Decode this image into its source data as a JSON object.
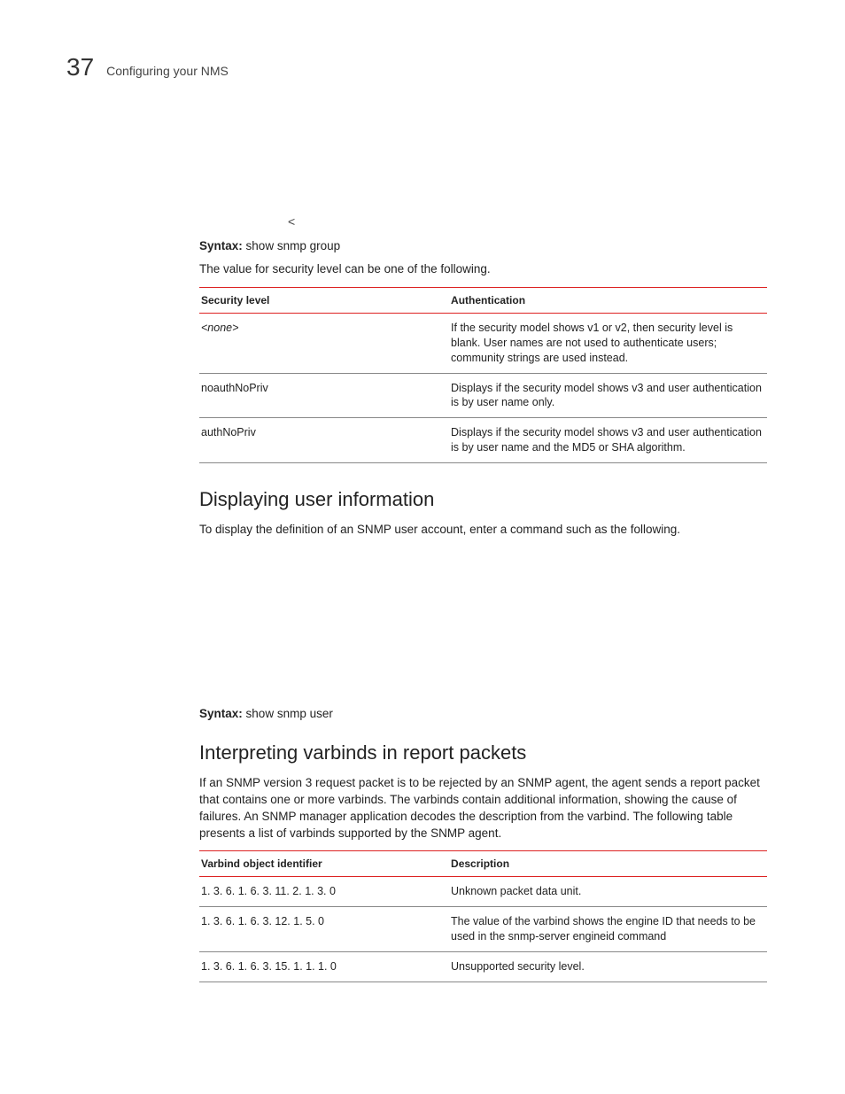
{
  "header": {
    "page_number": "37",
    "running_title": "Configuring your NMS"
  },
  "angle_char": "<",
  "syntax1": {
    "label": "Syntax:",
    "command": "show snmp group"
  },
  "security_intro": "The value for security level can be one of the following.",
  "security_table": {
    "col1": "Security level",
    "col2": "Authentication",
    "rows": [
      {
        "c1": "<none>",
        "c2": "If the security model shows v1 or v2, then security level is blank. User names are not used to authenticate users; community strings are used instead."
      },
      {
        "c1": "noauthNoPriv",
        "c2": "Displays if the security model shows v3 and user authentication is by user name only."
      },
      {
        "c1": "authNoPriv",
        "c2": "Displays if the security model shows v3 and user authentication is by user name and the MD5 or SHA algorithm."
      }
    ]
  },
  "section1": {
    "heading": "Displaying user information",
    "para": "To display the definition of an SNMP user account, enter a command such as the following."
  },
  "syntax2": {
    "label": "Syntax:",
    "command": "show snmp user"
  },
  "section2": {
    "heading": "Interpreting varbinds in report packets",
    "para": "If an SNMP version 3 request packet is to be rejected by an SNMP agent, the agent sends a report packet that contains one or more varbinds.  The varbinds contain additional information, showing the cause of failures.  An SNMP manager application decodes the description from the varbind.  The following table presents a list of varbinds supported by the SNMP agent."
  },
  "varbind_table": {
    "col1": "Varbind object identifier",
    "col2": "Description",
    "rows": [
      {
        "c1": "1. 3. 6. 1. 6. 3. 11. 2. 1. 3. 0",
        "c2": "Unknown packet data unit."
      },
      {
        "c1": "1. 3. 6. 1. 6. 3. 12. 1. 5. 0",
        "c2": "The value of the varbind shows the engine ID that needs to be used in the snmp-server engineid command"
      },
      {
        "c1": "1. 3. 6. 1. 6. 3. 15. 1. 1. 1. 0",
        "c2": "Unsupported security level."
      }
    ]
  }
}
